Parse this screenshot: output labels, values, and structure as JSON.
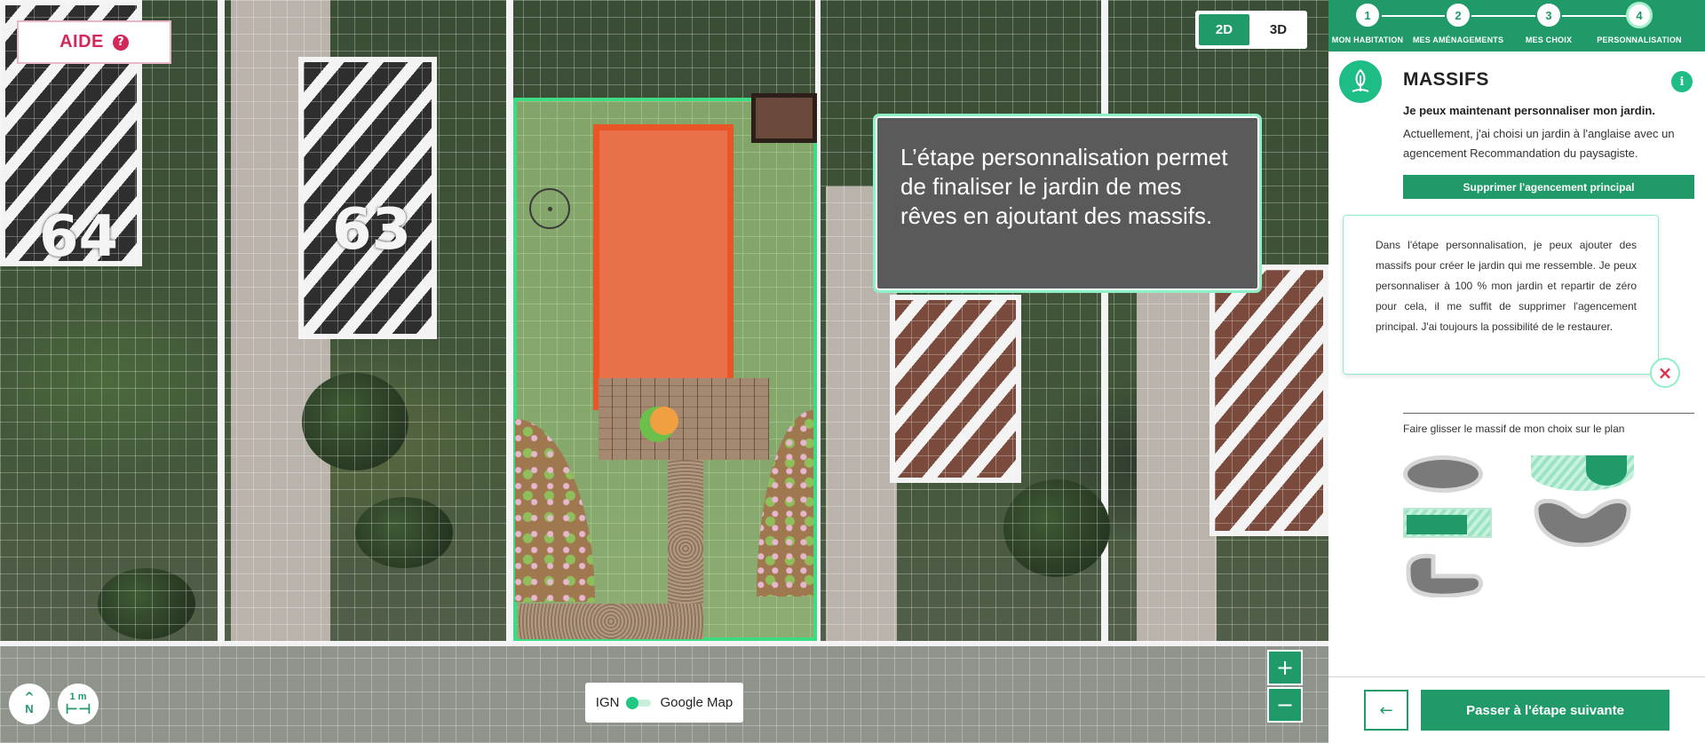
{
  "help": {
    "label": "AIDE",
    "icon": "question-circle-icon",
    "icon_glyph": "?"
  },
  "view_toggle": {
    "options": [
      "2D",
      "3D"
    ],
    "selected": "2D"
  },
  "map": {
    "lot_numbers": [
      "64",
      "63"
    ],
    "bubble_text": "L’étape personnalisation permet de finaliser le jardin de mes rêves en ajoutant des massifs.",
    "compass_label": "N",
    "scale_label": "1 m",
    "source_left": "IGN",
    "source_right": "Google Map",
    "zoom_in": "+",
    "zoom_out": "−"
  },
  "stepper": {
    "steps": [
      {
        "number": "1",
        "label": "MON HABITATION"
      },
      {
        "number": "2",
        "label": "MES AMÉNAGEMENTS"
      },
      {
        "number": "3",
        "label": "MES CHOIX"
      },
      {
        "number": "4",
        "label": "PERSONNALISATION"
      }
    ],
    "active_step": 4
  },
  "panel": {
    "section_icon": "tree-icon",
    "title": "MASSIFS",
    "intro_bold": "Je peux maintenant personnaliser mon jardin.",
    "intro_text": "Actuellement, j'ai choisi un jardin à l'anglaise avec un agencement Recommandation du paysagiste.",
    "delete_button": "Supprimer l'agencement principal",
    "tip_text": "Dans l'étape personnalisation, je peux ajouter des massifs pour créer le jardin qui me ressemble. Je peux personnaliser à 100 % mon jardin et repartir de zéro pour cela, il me suffit de supprimer l'agencement principal. J'ai toujours la possibilité de le restaurer.",
    "drag_hint": "Faire glisser le massif de mon choix sur le plan",
    "back_icon": "←",
    "next_button": "Passer à l'étape suivante"
  },
  "colors": {
    "accent": "#1f9a68",
    "accent_light": "#8ff0c6",
    "help_pink": "#d4285a",
    "close_red": "#e0304a"
  }
}
